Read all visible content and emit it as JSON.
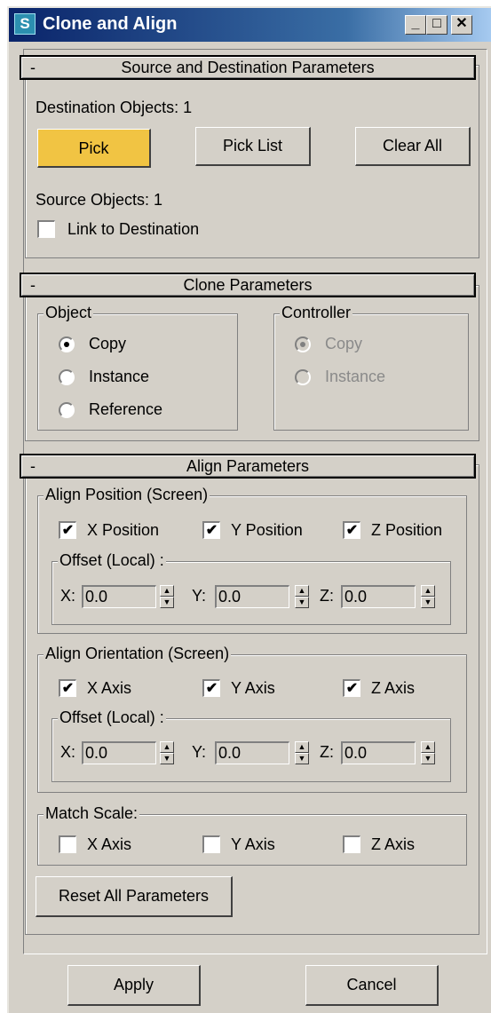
{
  "window": {
    "title": "Clone and Align",
    "icon": "app-s-icon",
    "controls": [
      "minimize-icon",
      "maximize-icon",
      "close-icon"
    ]
  },
  "source_dest": {
    "header": "Source and Destination Parameters",
    "collapse": "-",
    "dest_label": "Destination Objects:  1",
    "pick": "Pick",
    "pick_list": "Pick List",
    "clear_all": "Clear All",
    "source_label": "Source Objects:  1",
    "link_label": "Link to Destination",
    "link_checked": false,
    "pick_active_color": "#f1c443"
  },
  "clone": {
    "header": "Clone Parameters",
    "collapse": "-",
    "object_group": "Object",
    "object_options": [
      "Copy",
      "Instance",
      "Reference"
    ],
    "object_selected": "Copy",
    "controller_group": "Controller",
    "controller_options": [
      "Copy",
      "Instance"
    ],
    "controller_selected": "Copy",
    "controller_disabled": true
  },
  "align": {
    "header": "Align Parameters",
    "collapse": "-",
    "position_group": "Align Position (Screen)",
    "position_checks": [
      "X Position",
      "Y Position",
      "Z Position"
    ],
    "position_checked": [
      true,
      true,
      true
    ],
    "pos_offset_group": "Offset (Local) :",
    "pos_offset": {
      "x_label": "X:",
      "x": "0.0",
      "y_label": "Y:",
      "y": "0.0",
      "z_label": "Z:",
      "z": "0.0"
    },
    "orient_group": "Align Orientation (Screen)",
    "orient_checks": [
      "X Axis",
      "Y Axis",
      "Z Axis"
    ],
    "orient_checked": [
      true,
      true,
      true
    ],
    "orient_offset_group": "Offset (Local) :",
    "orient_offset": {
      "x_label": "X:",
      "x": "0.0",
      "y_label": "Y:",
      "y": "0.0",
      "z_label": "Z:",
      "z": "0.0"
    },
    "scale_group": "Match Scale:",
    "scale_checks": [
      "X Axis",
      "Y Axis",
      "Z Axis"
    ],
    "scale_checked": [
      false,
      false,
      false
    ],
    "reset": "Reset All Parameters"
  },
  "footer": {
    "apply": "Apply",
    "cancel": "Cancel"
  },
  "checkmark": "✔"
}
